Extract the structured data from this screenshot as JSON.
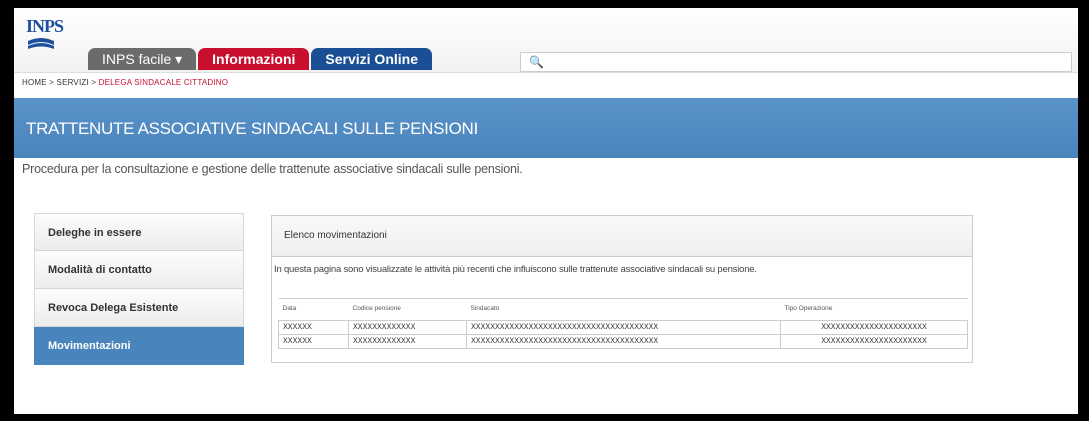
{
  "header": {
    "logo_text": "INPS",
    "tabs": [
      {
        "label": "INPS facile ▾",
        "color": "#6b6b6b"
      },
      {
        "label": "Informazioni",
        "color": "#c8102e"
      },
      {
        "label": "Servizi Online",
        "color": "#1b4f95"
      }
    ],
    "search": {
      "placeholder": "",
      "icon": "search-icon"
    }
  },
  "breadcrumb": {
    "items": [
      "HOME",
      "SERVIZI"
    ],
    "separator": " > ",
    "current": "DELEGA SINDACALE CITTADINO"
  },
  "banner": {
    "title": "TRATTENUTE ASSOCIATIVE SINDACALI SULLE PENSIONI",
    "color": "#4a84bd"
  },
  "description": "Procedura per la consultazione e gestione delle trattenute associative sindacali sulle pensioni.",
  "sidebar": {
    "items": [
      {
        "label": "Deleghe in essere",
        "active": false
      },
      {
        "label": "Modalità di contatto",
        "active": false
      },
      {
        "label": "Revoca Delega Esistente",
        "active": false
      },
      {
        "label": "Movimentazioni",
        "active": true
      }
    ]
  },
  "panel": {
    "title": "Elenco movimentazioni",
    "info": "In questa pagina sono visualizzate le attività più recenti che influiscono sulle trattenute associative sindacali su pensione.",
    "columns": [
      "Data",
      "Codice pensione",
      "Sindacato",
      "Tipo Operazione"
    ],
    "rows": [
      [
        "XXXXXX",
        "XXXXXXXXXXXXX",
        "XXXXXXXXXXXXXXXXXXXXXXXXXXXXXXXXXXXXXXX",
        "XXXXXXXXXXXXXXXXXXXXXX"
      ],
      [
        "XXXXXX",
        "XXXXXXXXXXXXX",
        "XXXXXXXXXXXXXXXXXXXXXXXXXXXXXXXXXXXXXXX",
        "XXXXXXXXXXXXXXXXXXXXXX"
      ]
    ]
  }
}
